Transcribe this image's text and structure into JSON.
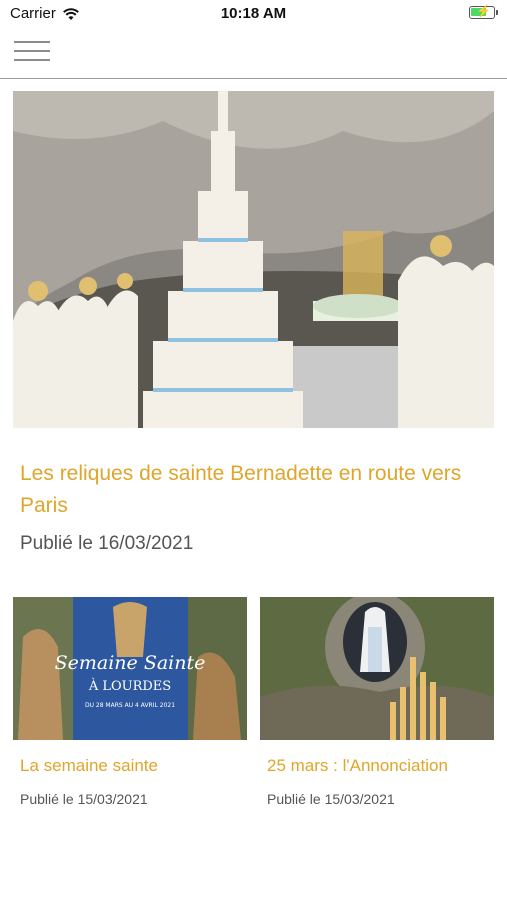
{
  "status_bar": {
    "carrier": "Carrier",
    "time": "10:18 AM",
    "battery_level": 0.7
  },
  "nav": {
    "menu_icon": "hamburger-menu-icon"
  },
  "hero": {
    "title": "Les reliques de sainte  Bernadette en route vers  Paris",
    "date": "Publié le 16/03/2021"
  },
  "cards": [
    {
      "image_text_line1": "Semaine Sainte",
      "image_text_line2": "À LOURDES",
      "image_text_line3": "DU 28 MARS AU 4 AVRIL 2021",
      "title": "La semaine sainte",
      "date": "Publié le 15/03/2021"
    },
    {
      "title": "25 mars : l'Annonciation",
      "date": "Publié le 15/03/2021"
    }
  ],
  "colors": {
    "accent": "#e0a52a",
    "text_secondary": "#555555",
    "divider": "#9a9a9a"
  }
}
